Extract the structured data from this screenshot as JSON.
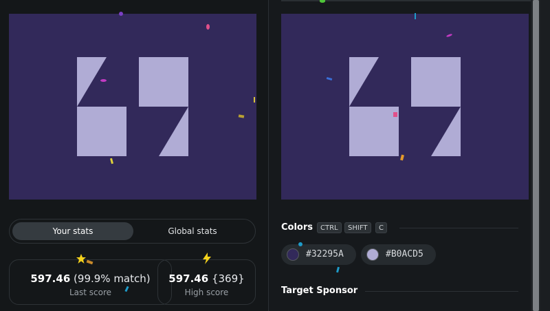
{
  "stats": {
    "tabs": [
      {
        "label": "Your stats",
        "active": true
      },
      {
        "label": "Global stats",
        "active": false
      }
    ],
    "last": {
      "score": "597.46",
      "match": "(99.9% match)",
      "label": "Last score"
    },
    "high": {
      "score": "597.46",
      "count": "{369}",
      "label": "High score"
    }
  },
  "colors": {
    "title": "Colors",
    "keys": [
      "CTRL",
      "SHIFT",
      "C"
    ],
    "swatches": [
      {
        "hex": "#32295A"
      },
      {
        "hex": "#B0ACD5"
      }
    ]
  },
  "sponsor": {
    "title": "Target Sponsor"
  },
  "icons": {
    "last_score": "star-icon",
    "high_score": "lightning-icon"
  },
  "palette": {
    "background": "#32295A",
    "foreground": "#B0ACD5"
  }
}
